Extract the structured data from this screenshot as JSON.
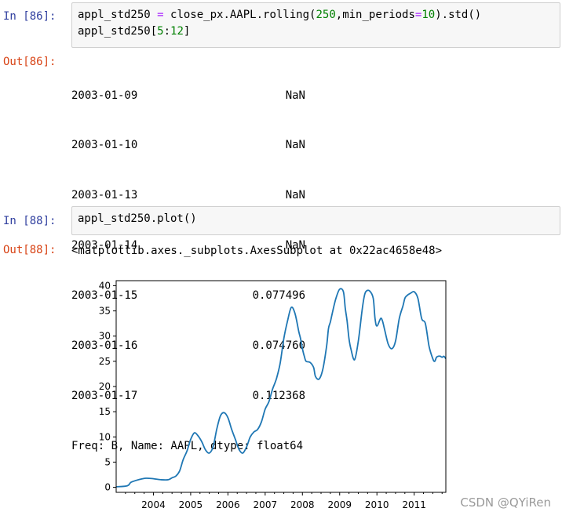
{
  "cells": [
    {
      "in_prompt": "In  [86]:",
      "code_line1": {
        "a": "appl_std250 ",
        "op": "=",
        "b": " close_px.AAPL.rolling(",
        "n1": "250",
        "c": ",min_periods",
        "op2": "=",
        "n2": "10",
        "d": ").std()"
      },
      "code_line2": {
        "a": "appl_std250[",
        "n1": "5",
        "c": ":",
        "n2": "12",
        "d": "]"
      },
      "out_prompt": "Out[86]:",
      "series": [
        {
          "date": "2003-01-09",
          "value": "NaN"
        },
        {
          "date": "2003-01-10",
          "value": "NaN"
        },
        {
          "date": "2003-01-13",
          "value": "NaN"
        },
        {
          "date": "2003-01-14",
          "value": "NaN"
        },
        {
          "date": "2003-01-15",
          "value": "0.077496"
        },
        {
          "date": "2003-01-16",
          "value": "0.074760"
        },
        {
          "date": "2003-01-17",
          "value": "0.112368"
        }
      ],
      "series_footer": "Freq: B, Name: AAPL, dtype: float64"
    },
    {
      "in_prompt": "In  [88]:",
      "code": "appl_std250.plot()",
      "out_prompt": "Out[88]:",
      "out_text": "<matplotlib.axes._subplots.AxesSubplot at 0x22ac4658e48>"
    }
  ],
  "chart_data": {
    "type": "line",
    "xlabel": "",
    "ylabel": "",
    "ylim": [
      -1,
      41
    ],
    "xlim": [
      2003.0,
      2011.85
    ],
    "yticks": [
      0,
      5,
      10,
      15,
      20,
      25,
      30,
      35,
      40
    ],
    "xticks": [
      "2004",
      "2005",
      "2006",
      "2007",
      "2008",
      "2009",
      "2010",
      "2011"
    ],
    "grid": false,
    "line_color": "#1f77b4",
    "x": [
      2003.0,
      2003.3,
      2003.4,
      2003.6,
      2003.8,
      2004.0,
      2004.2,
      2004.4,
      2004.5,
      2004.6,
      2004.7,
      2004.8,
      2004.9,
      2005.0,
      2005.1,
      2005.2,
      2005.3,
      2005.4,
      2005.5,
      2005.6,
      2005.7,
      2005.8,
      2005.9,
      2006.0,
      2006.1,
      2006.2,
      2006.3,
      2006.4,
      2006.5,
      2006.6,
      2006.7,
      2006.8,
      2006.9,
      2007.0,
      2007.1,
      2007.2,
      2007.3,
      2007.4,
      2007.5,
      2007.6,
      2007.7,
      2007.8,
      2007.9,
      2007.95,
      2008.0,
      2008.05,
      2008.1,
      2008.2,
      2008.3,
      2008.35,
      2008.45,
      2008.55,
      2008.65,
      2008.7,
      2008.75,
      2008.8,
      2008.9,
      2009.0,
      2009.1,
      2009.15,
      2009.2,
      2009.25,
      2009.3,
      2009.4,
      2009.5,
      2009.6,
      2009.65,
      2009.7,
      2009.8,
      2009.9,
      2009.95,
      2010.0,
      2010.1,
      2010.15,
      2010.2,
      2010.3,
      2010.4,
      2010.5,
      2010.6,
      2010.7,
      2010.75,
      2010.8,
      2010.9,
      2011.0,
      2011.1,
      2011.2,
      2011.3,
      2011.4,
      2011.5,
      2011.55,
      2011.6,
      2011.65,
      2011.7,
      2011.75,
      2011.8,
      2011.85
    ],
    "y": [
      0.1,
      0.3,
      1.0,
      1.5,
      1.8,
      1.7,
      1.5,
      1.5,
      1.9,
      2.2,
      3.2,
      5.5,
      7.2,
      9.5,
      10.8,
      10.2,
      9.0,
      7.4,
      6.8,
      8.0,
      11.5,
      14.2,
      14.8,
      13.8,
      11.5,
      9.5,
      7.5,
      6.8,
      8.0,
      10.0,
      11.0,
      11.5,
      13.0,
      15.5,
      17.0,
      19.5,
      21.5,
      24.5,
      29.5,
      33.0,
      35.7,
      34.5,
      31.0,
      29.5,
      27.5,
      26.0,
      25.0,
      24.8,
      23.8,
      22.0,
      21.5,
      23.5,
      28.0,
      31.5,
      32.8,
      34.5,
      37.5,
      39.3,
      38.8,
      35.5,
      33.0,
      29.5,
      27.5,
      25.3,
      29.0,
      35.0,
      37.5,
      38.8,
      39.0,
      37.5,
      33.5,
      32.0,
      33.5,
      33.0,
      31.5,
      28.5,
      27.5,
      29.0,
      33.5,
      36.0,
      37.5,
      38.0,
      38.5,
      38.8,
      37.5,
      33.5,
      32.5,
      28.0,
      25.5,
      25.0,
      25.8,
      26.0,
      26.0,
      25.8,
      26.0,
      25.5
    ]
  },
  "watermark": "CSDN @QYiRen"
}
